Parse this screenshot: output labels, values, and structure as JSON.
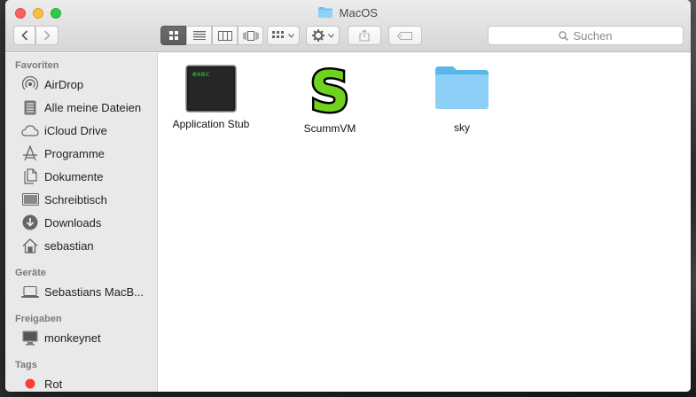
{
  "window": {
    "title": "MacOS",
    "folder_color": "#6bc1f5"
  },
  "toolbar": {
    "back_icon": "chevron-left-icon",
    "forward_icon": "chevron-right-icon",
    "view_icons": [
      "icon-view-icon",
      "list-view-icon",
      "column-view-icon",
      "cover-flow-icon"
    ],
    "arrange_icon": "group-icon",
    "action_icon": "gear-icon",
    "share_icon": "share-icon",
    "tag_icon": "tag-icon",
    "search_placeholder": "Suchen"
  },
  "sidebar": {
    "favorites_title": "Favoriten",
    "favorites": [
      {
        "label": "AirDrop",
        "icon": "airdrop-icon"
      },
      {
        "label": "Alle meine Dateien",
        "icon": "all-files-icon"
      },
      {
        "label": "iCloud Drive",
        "icon": "cloud-icon"
      },
      {
        "label": "Programme",
        "icon": "applications-icon"
      },
      {
        "label": "Dokumente",
        "icon": "document-icon"
      },
      {
        "label": "Schreibtisch",
        "icon": "desktop-icon"
      },
      {
        "label": "Downloads",
        "icon": "download-icon"
      },
      {
        "label": "sebastian",
        "icon": "home-icon"
      }
    ],
    "devices_title": "Geräte",
    "devices": [
      {
        "label": "Sebastians MacB...",
        "icon": "laptop-icon"
      }
    ],
    "shared_title": "Freigaben",
    "shared": [
      {
        "label": "monkeynet",
        "icon": "monitor-icon"
      }
    ],
    "tags_title": "Tags",
    "tags": [
      {
        "label": "Rot",
        "color": "#fc3d39"
      }
    ]
  },
  "files": [
    {
      "name": "Application Stub",
      "icon": "exec-icon",
      "icon_text": "exec"
    },
    {
      "name": "ScummVM",
      "icon": "scummvm-icon",
      "icon_text": "S"
    },
    {
      "name": "sky",
      "icon": "folder-icon"
    }
  ]
}
